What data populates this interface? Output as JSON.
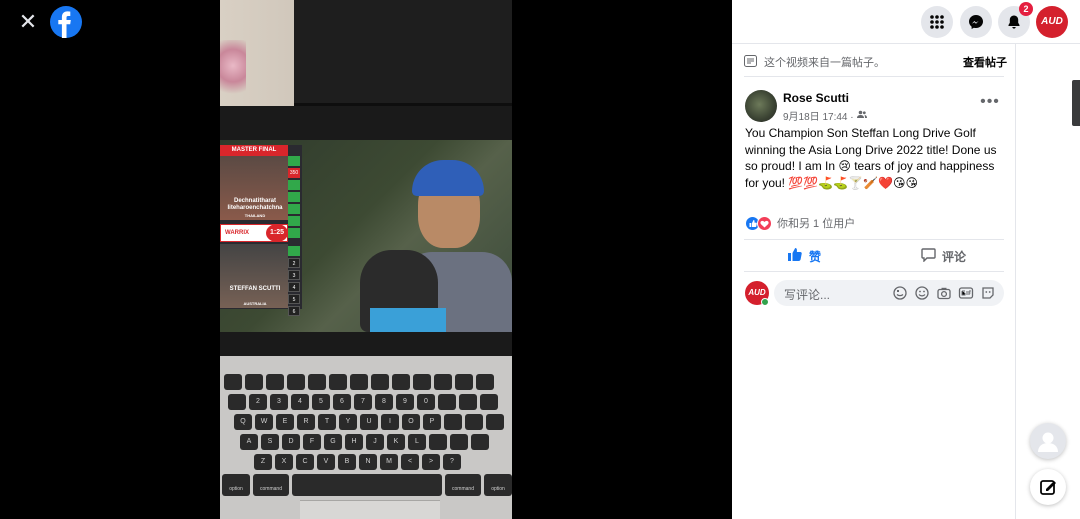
{
  "viewer": {
    "video_overlay": {
      "board_title": "MASTER FINAL",
      "player1_name": "Dechnatitharat Iiteharoenchatchna",
      "player1_country": "THAILAND",
      "player2_name": "STEFFAN SCUTTI",
      "player2_country": "AUSTRALIA",
      "sponsor": "WARRIX",
      "timer": "1:25",
      "scores_top": [
        "",
        "350",
        "",
        "",
        "",
        "",
        ""
      ],
      "scores_bottom": [
        "",
        "2",
        "3",
        "4",
        "5",
        "6"
      ]
    },
    "keyboard_rows": [
      [
        "",
        "",
        "",
        "",
        "",
        "",
        "",
        "",
        "",
        "",
        "",
        "",
        ""
      ],
      [
        "",
        "2",
        "3",
        "4",
        "5",
        "6",
        "7",
        "8",
        "9",
        "0",
        "",
        "",
        ""
      ],
      [
        "Q",
        "W",
        "E",
        "R",
        "T",
        "Y",
        "U",
        "I",
        "O",
        "P",
        "",
        "",
        ""
      ],
      [
        "A",
        "S",
        "D",
        "F",
        "G",
        "H",
        "J",
        "K",
        "L",
        "",
        "",
        ""
      ],
      [
        "Z",
        "X",
        "C",
        "V",
        "B",
        "N",
        "M",
        "<",
        ">",
        "?"
      ],
      [
        "option",
        "command",
        "",
        "command",
        "option"
      ]
    ]
  },
  "topbar": {
    "notification_count": "2",
    "profile_logo_text": "AUD"
  },
  "post": {
    "source_text": "这个视频来自一篇帖子。",
    "view_post_label": "查看帖子",
    "author": "Rose Scutti",
    "date": "9月18日 17:44 ·",
    "body": "You Champion Son Steffan Long Drive Golf winning the Asia Long Drive 2022 title! Done us so proud! I am In 😢 tears of joy and happiness for you! 💯💯⛳⛳🍸🏏❤️😘😘",
    "reactions_text": "你和另 1 位用户",
    "like_label": "赞",
    "comment_label": "评论",
    "comment_placeholder": "写评论...",
    "commenter_logo_text": "AUD"
  },
  "colors": {
    "brand_blue": "#1877f2",
    "love_red": "#f33e58",
    "badge_red": "#e41e3f",
    "logo_red": "#d4202d",
    "online_green": "#31a24c"
  },
  "icons": [
    "close-icon",
    "facebook-logo-icon",
    "grid-menu-icon",
    "messenger-icon",
    "bell-icon",
    "document-icon",
    "friends-audience-icon",
    "more-icon",
    "like-icon",
    "comment-icon",
    "sticker-icon",
    "emoji-icon",
    "camera-icon",
    "gif-icon",
    "avatar-sticker-icon",
    "contacts-icon",
    "compose-icon"
  ]
}
